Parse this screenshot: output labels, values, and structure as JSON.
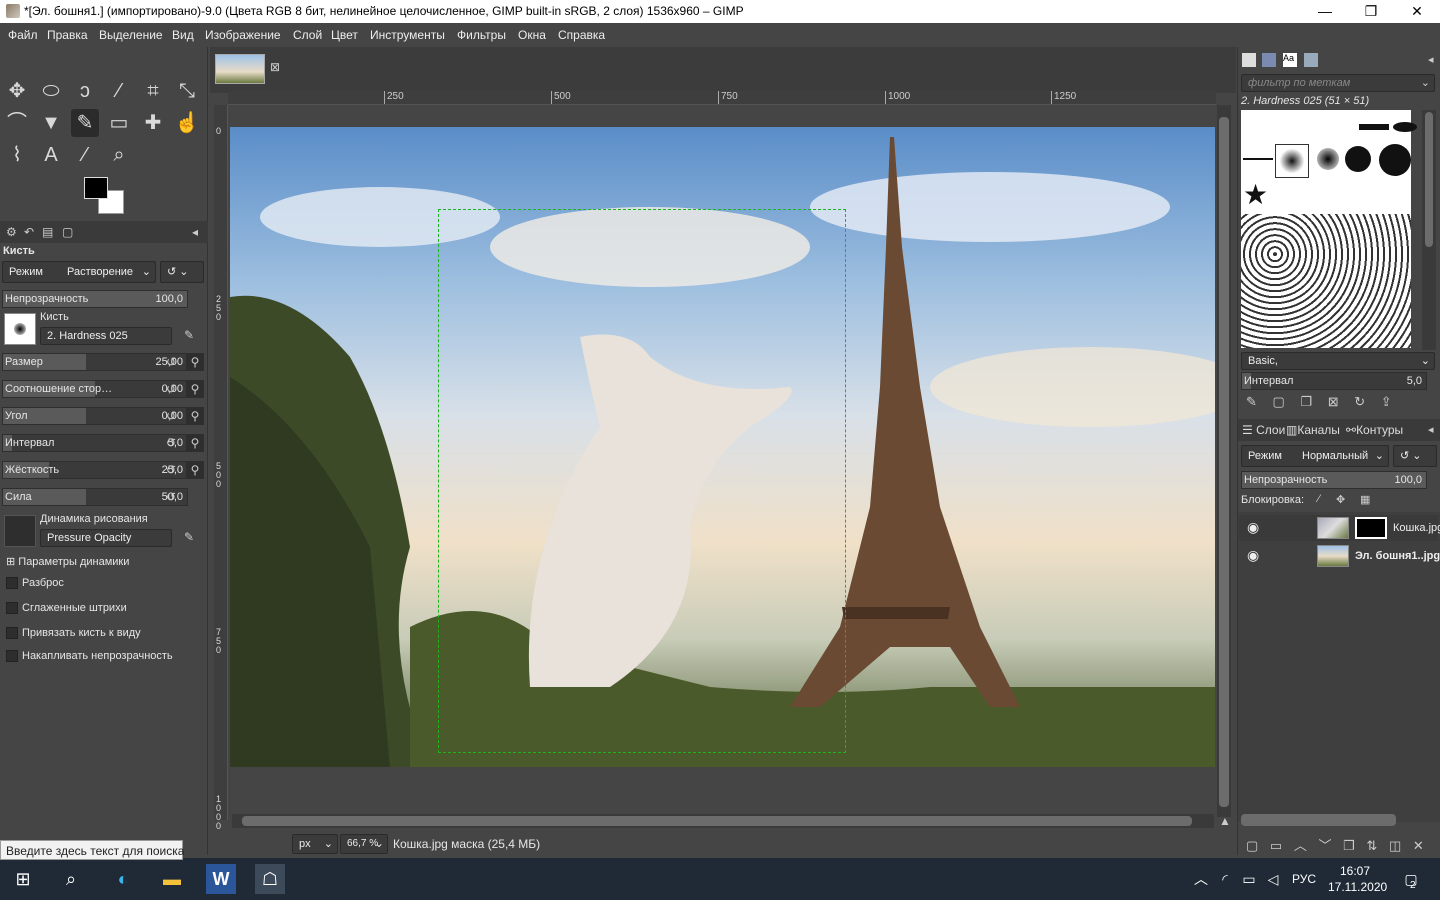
{
  "window": {
    "title": "*[Эл. бошня1.] (импортировано)-9.0 (Цвета RGB 8 бит, нелинейное целочисленное, GIMP built-in sRGB, 2 слоя) 1536x960 – GIMP",
    "minimize": "—",
    "maximize": "❐",
    "close": "✕"
  },
  "menu": [
    "Файл",
    "Правка",
    "Выделение",
    "Вид",
    "Изображение",
    "Слой",
    "Цвет",
    "Инструменты",
    "Фильтры",
    "Окна",
    "Справка"
  ],
  "toolbox": {
    "tools": [
      "move-icon",
      "ellipse-select-icon",
      "free-select-icon",
      "fuzzy-select-icon",
      "crop-icon",
      "transform-icon",
      "warp-icon",
      "bucket-fill-icon",
      "paintbrush-icon",
      "eraser-icon",
      "heal-icon",
      "smudge-icon",
      "paths-icon",
      "text-icon",
      "color-picker-icon",
      "zoom-icon"
    ],
    "active_tool": "paintbrush-icon",
    "fg_color": "#000000",
    "bg_color": "#ffffff"
  },
  "tool_options": {
    "title": "Кисть",
    "mode_label": "Режим",
    "mode_value": "Растворение",
    "opacity_label": "Непрозрачность",
    "opacity_value": "100,0",
    "brush_label": "Кисть",
    "brush_value": "2. Hardness 025",
    "sliders": [
      {
        "label": "Размер",
        "value": "25,00",
        "fill": 0.45
      },
      {
        "label": "Соотношение стор…",
        "value": "0,00",
        "fill": 0.5
      },
      {
        "label": "Угол",
        "value": "0,00",
        "fill": 0.45
      },
      {
        "label": "Интервал",
        "value": "5,0",
        "fill": 0.05
      },
      {
        "label": "Жёсткость",
        "value": "25,0",
        "fill": 0.25
      },
      {
        "label": "Сила",
        "value": "50,0",
        "fill": 0.45
      }
    ],
    "dynamics_label": "Динамика рисования",
    "dynamics_value": "Pressure Opacity",
    "dynamics_params": "Параметры динамики",
    "checkboxes": [
      "Разброс",
      "Сглаженные штрихи",
      "Привязать кисть к виду",
      "Накапливать непрозрачность"
    ]
  },
  "canvas": {
    "ruler_ticks": [
      "250",
      "500",
      "750",
      "1000",
      "1250"
    ],
    "vruler_ticks": [
      "0",
      "250",
      "500",
      "750",
      "1000"
    ]
  },
  "status": {
    "unit": "px",
    "zoom": "66,7 %",
    "message": "Кошка.jpg маска (25,4 МБ)"
  },
  "brushes_panel": {
    "filter_placeholder": "фильтр по меткам",
    "brush_title": "2. Hardness 025 (51 × 51)",
    "tag": "Basic,",
    "spacing_label": "Интервал",
    "spacing_value": "5,0"
  },
  "layers_panel": {
    "tabs": [
      "Слои",
      "Каналы",
      "Контуры"
    ],
    "mode_label": "Режим",
    "mode_value": "Нормальный",
    "opacity_label": "Непрозрачность",
    "opacity_value": "100,0",
    "lock_label": "Блокировка:",
    "layers": [
      {
        "name": "Кошка.jpg",
        "selected": true
      },
      {
        "name": "Эл. бошня1..jpg",
        "selected": false
      }
    ]
  },
  "taskbar": {
    "search_tooltip": "Введите здесь текст для поиска",
    "lang": "РУС",
    "time": "16:07",
    "date": "17.11.2020",
    "notifications": "2"
  }
}
